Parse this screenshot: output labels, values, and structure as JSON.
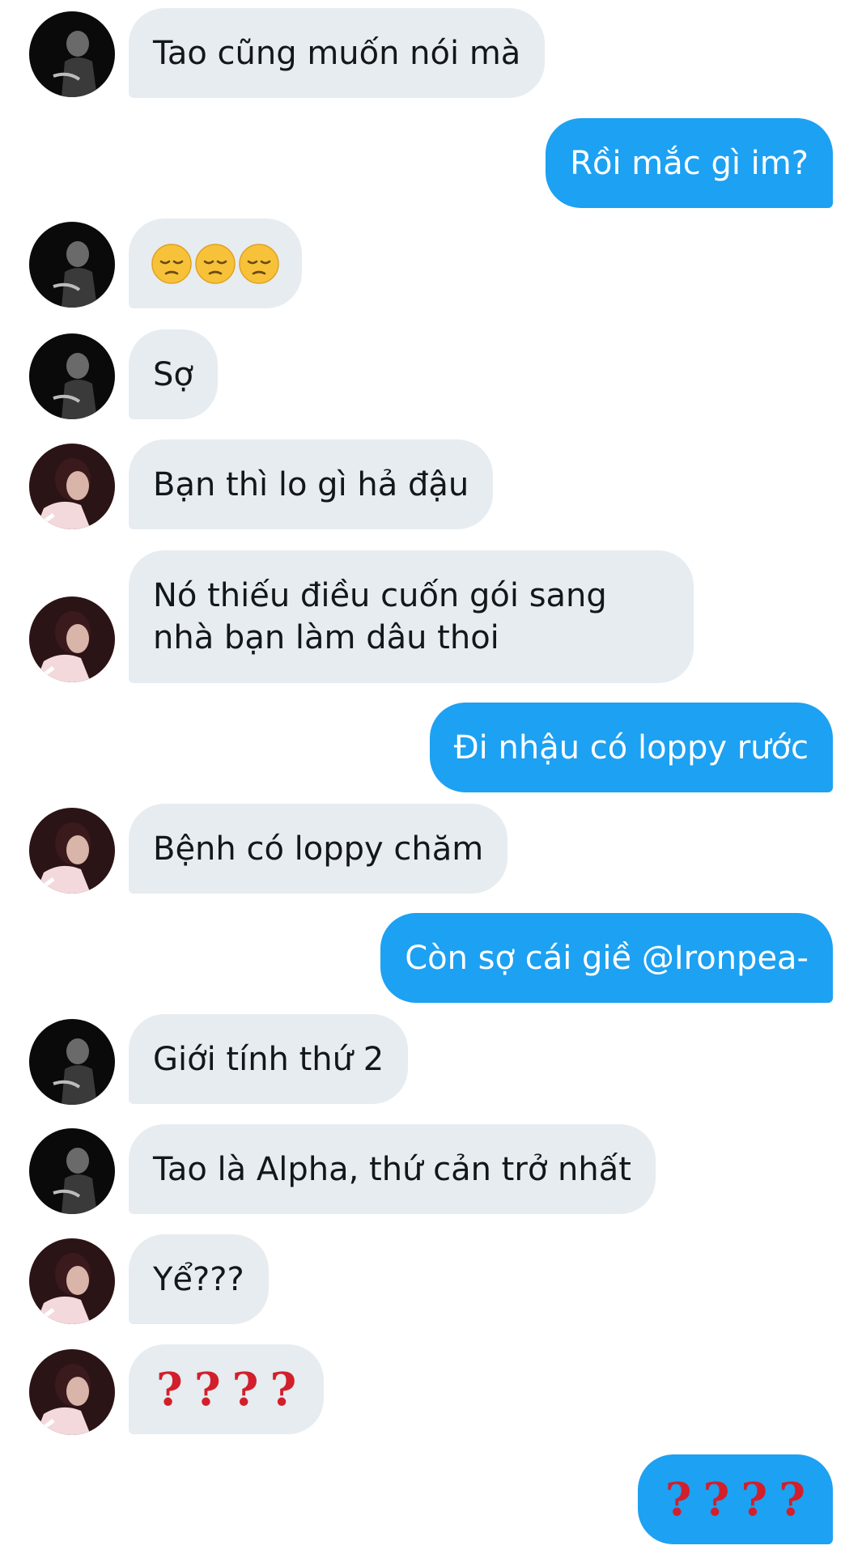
{
  "messages": [
    {
      "id": 1,
      "side": "left",
      "avatar": "dark",
      "text": "Tao cũng muốn nói mà"
    },
    {
      "id": 2,
      "side": "right",
      "text": "Rồi mắc gì im?"
    },
    {
      "id": 3,
      "side": "left",
      "avatar": "dark",
      "emoji": [
        "pensive-face",
        "pensive-face",
        "pensive-face"
      ]
    },
    {
      "id": 4,
      "side": "left",
      "avatar": "dark",
      "text": "Sợ"
    },
    {
      "id": 5,
      "side": "left",
      "avatar": "pink",
      "text": "Bạn thì lo gì hả đậu"
    },
    {
      "id": 6,
      "side": "left",
      "avatar": "pink",
      "lines": [
        "Nó thiếu điều cuốn gói sang",
        "nhà bạn làm dâu thoi"
      ]
    },
    {
      "id": 7,
      "side": "right",
      "text": "Đi nhậu có loppy rước"
    },
    {
      "id": 8,
      "side": "left",
      "avatar": "pink",
      "text": "Bệnh có loppy chăm"
    },
    {
      "id": 9,
      "side": "right",
      "text": "Còn sợ cái giề @Ironpea-"
    },
    {
      "id": 10,
      "side": "left",
      "avatar": "dark",
      "text": "Giới tính thứ 2"
    },
    {
      "id": 11,
      "side": "left",
      "avatar": "dark",
      "text": "Tao là Alpha, thứ cản trở nhất"
    },
    {
      "id": 12,
      "side": "left",
      "avatar": "pink",
      "text": "Yể???"
    },
    {
      "id": 13,
      "side": "left",
      "avatar": "pink",
      "marks": [
        "?",
        "?",
        "?",
        "?"
      ]
    },
    {
      "id": 14,
      "side": "right",
      "marks": [
        "?",
        "?",
        "?",
        "?"
      ]
    }
  ],
  "colors": {
    "left_bubble": "#e6ecf0",
    "right_bubble": "#1da1f2",
    "question_mark": "#d21f2b"
  }
}
